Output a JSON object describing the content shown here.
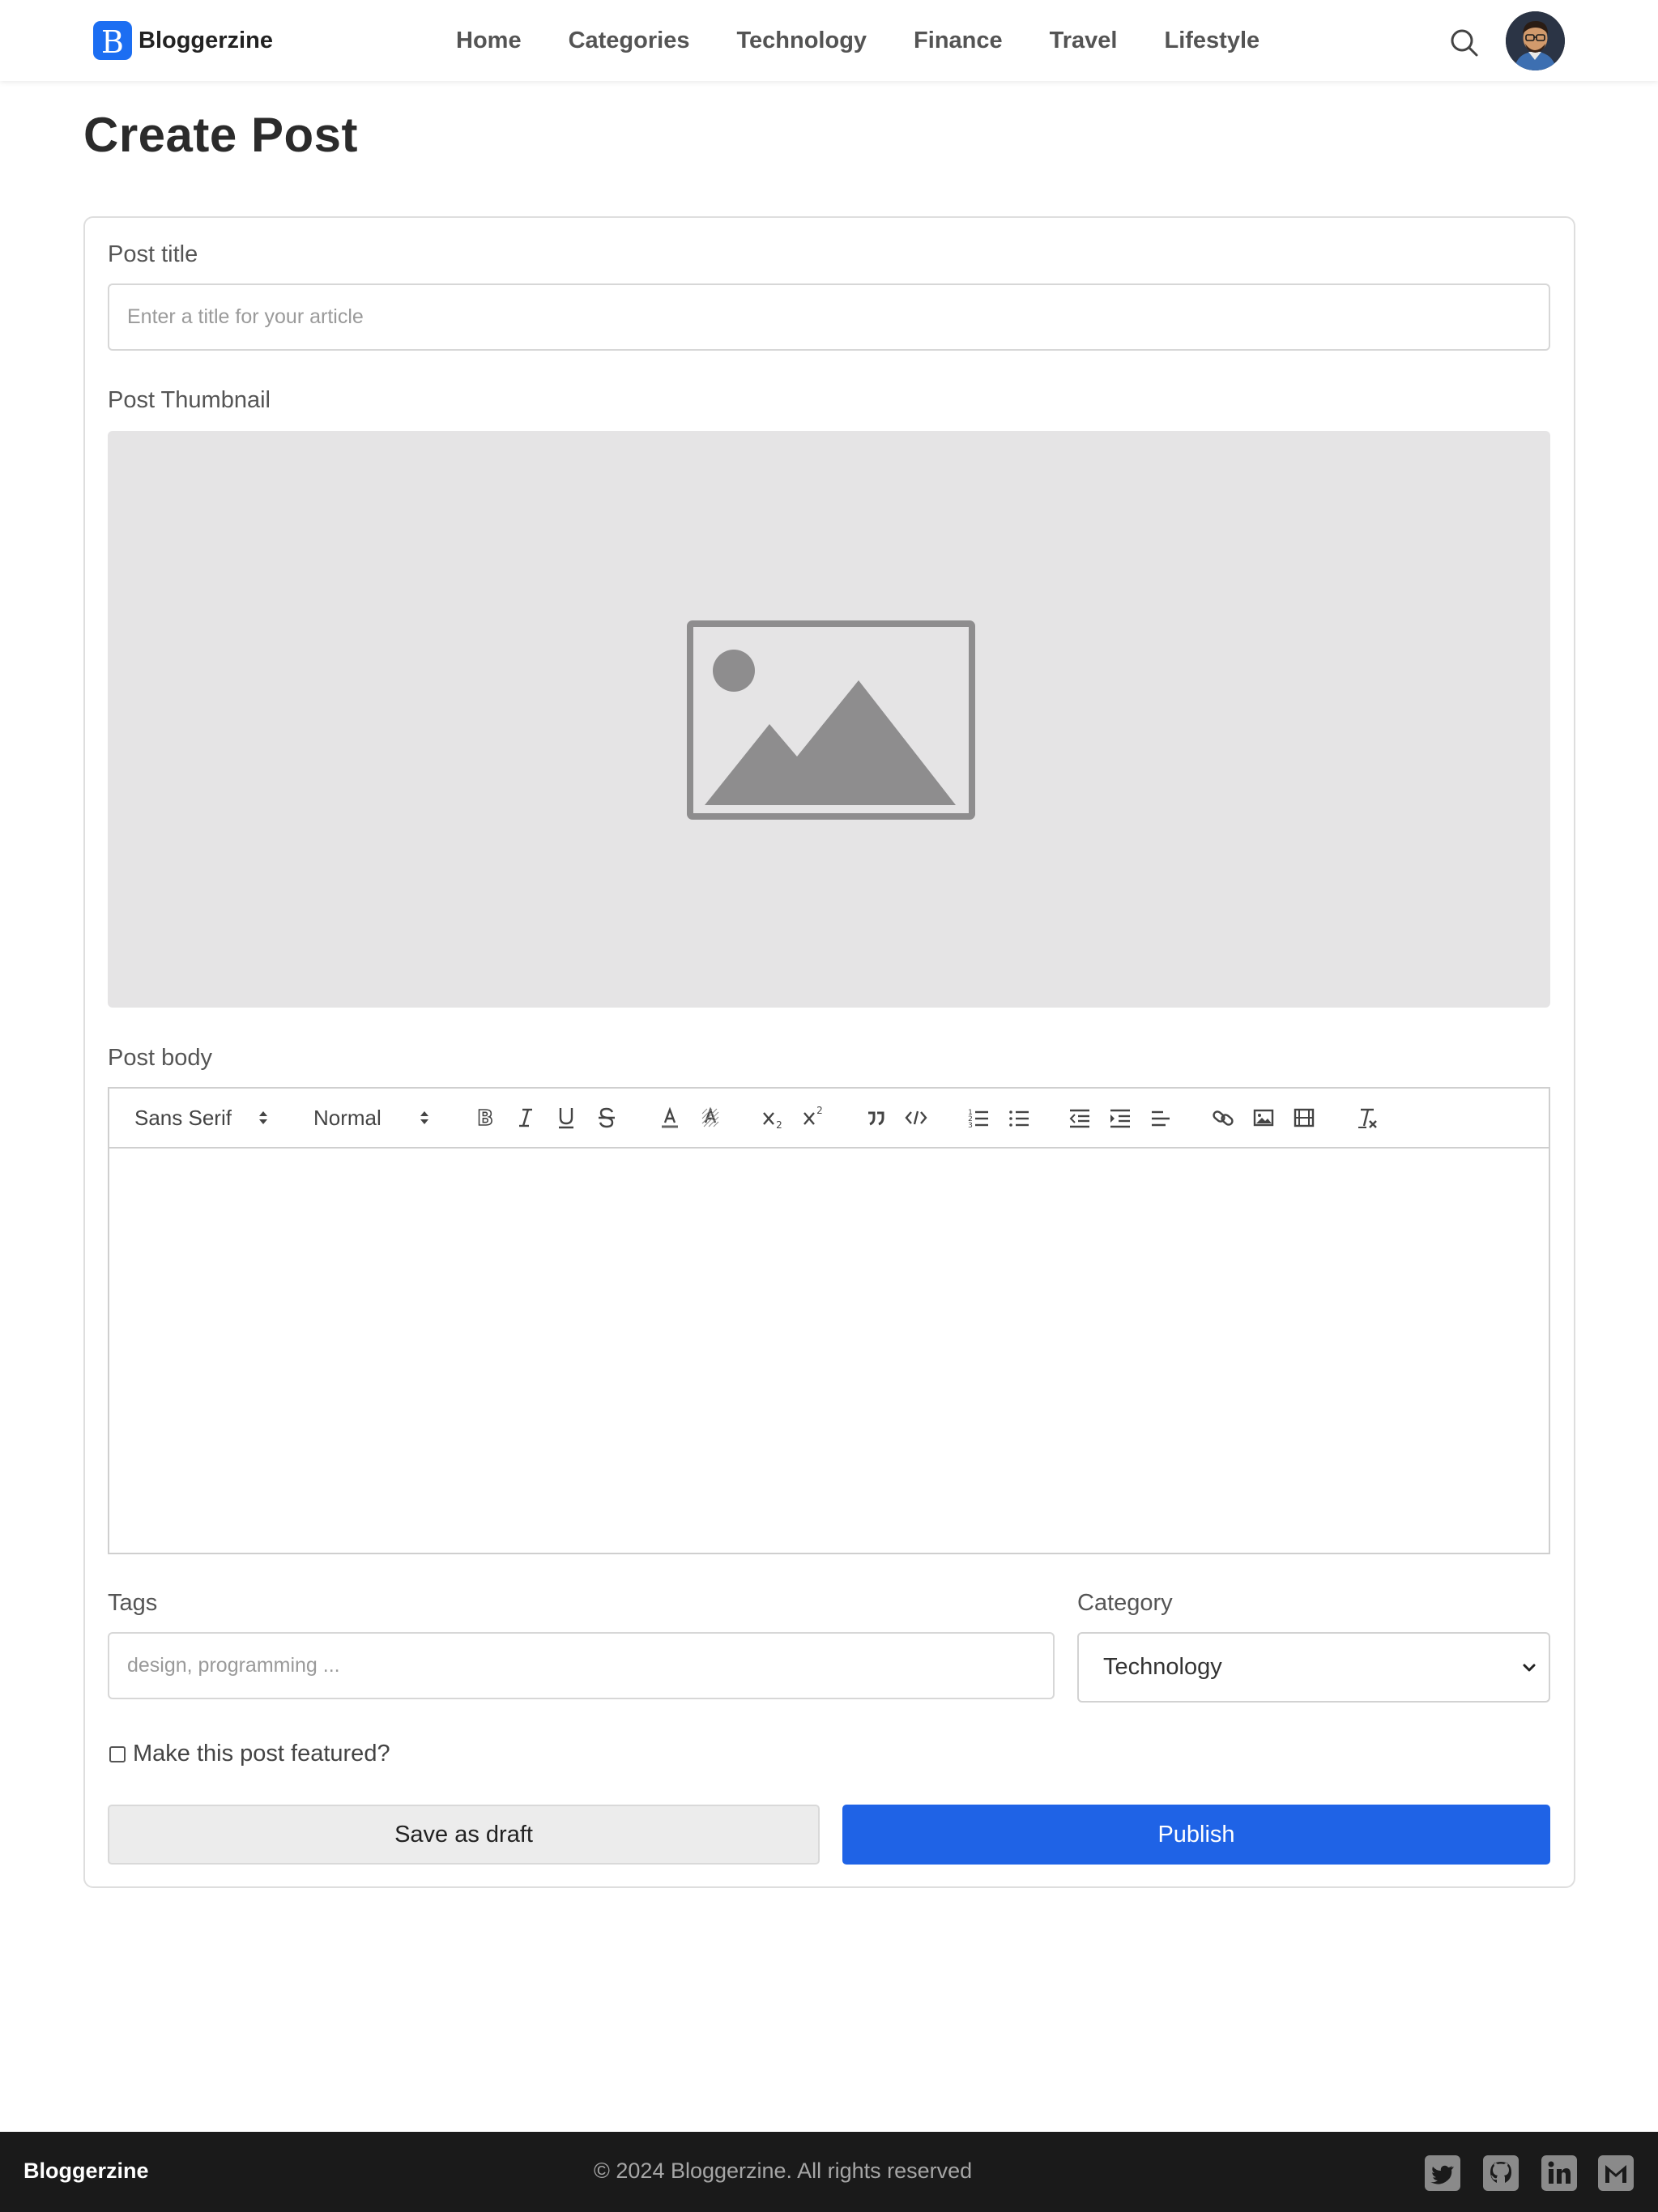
{
  "brand": {
    "name": "Bloggerzine",
    "logo_letter": "B"
  },
  "nav": {
    "links": [
      "Home",
      "Categories",
      "Technology",
      "Finance",
      "Travel",
      "Lifestyle"
    ],
    "search_icon": "search-icon",
    "avatar_icon": "user-avatar"
  },
  "page": {
    "title": "Create Post"
  },
  "form": {
    "title_label": "Post title",
    "title_placeholder": "Enter a title for your article",
    "title_value": "",
    "thumbnail_label": "Post Thumbnail",
    "thumbnail_icon": "image-placeholder-icon",
    "body_label": "Post body",
    "body_value": "",
    "tags_label": "Tags",
    "tags_placeholder": "design, programming ...",
    "tags_value": "",
    "category_label": "Category",
    "category_value": "Technology",
    "featured_label": "Make this post featured?",
    "featured_checked": false,
    "draft_button": "Save as draft",
    "publish_button": "Publish"
  },
  "editor_toolbar": {
    "font": "Sans Serif",
    "size": "Normal",
    "buttons": [
      "bold",
      "italic",
      "underline",
      "strike",
      "font-color",
      "background-color",
      "subscript",
      "superscript",
      "blockquote",
      "code",
      "ordered-list",
      "bullet-list",
      "outdent",
      "indent",
      "align",
      "link",
      "image",
      "video",
      "clean"
    ]
  },
  "footer": {
    "brand": "Bloggerzine",
    "copyright": "© 2024 Bloggerzine. All rights reserved",
    "social_icons": [
      "twitter-icon",
      "github-icon",
      "linkedin-icon",
      "gmail-icon"
    ]
  },
  "colors": {
    "accent": "#1f63e6",
    "brand_logo": "#1c6ef2",
    "footer_bg": "#1a1a1a",
    "thumbnail_bg": "#e5e4e5",
    "placeholder_icon": "#8e8d8e"
  }
}
